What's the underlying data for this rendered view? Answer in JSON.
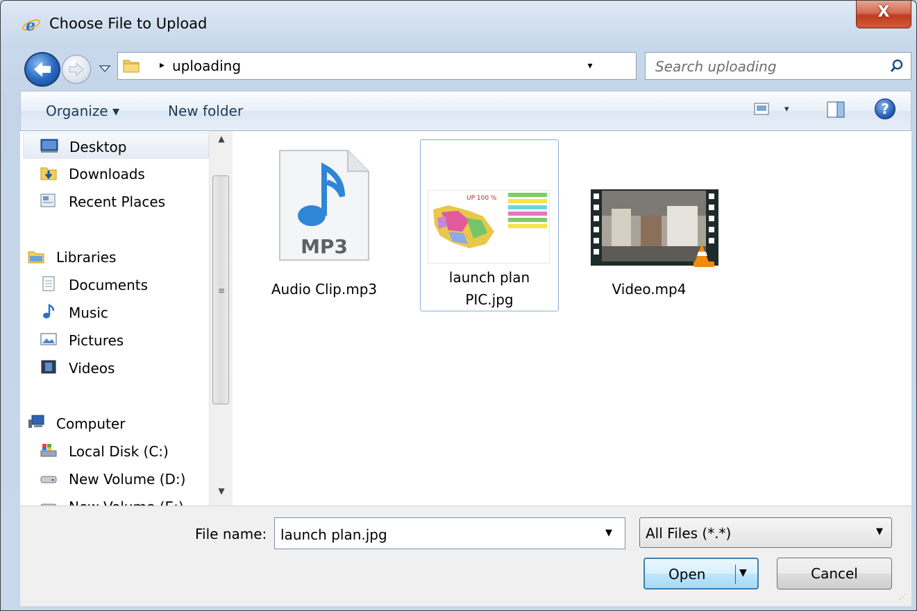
{
  "window": {
    "title": "Choose File to Upload",
    "close_label": "X"
  },
  "address": {
    "breadcrumb_arrow": "▸",
    "current_folder": "uploading",
    "dropdown_glyph": "▾",
    "refresh_glyph": "↻"
  },
  "search": {
    "placeholder": "Search uploading"
  },
  "toolbar": {
    "organize_label": "Organize ▾",
    "new_folder_label": "New folder",
    "view_dropdown": "▾",
    "help_label": "?"
  },
  "navigation": {
    "items": [
      {
        "label": "Desktop",
        "icon": "desktop-icon",
        "selected": true
      },
      {
        "label": "Downloads",
        "icon": "downloads-folder-icon"
      },
      {
        "label": "Recent Places",
        "icon": "recent-places-icon"
      },
      {
        "label": "Libraries",
        "icon": "libraries-icon"
      },
      {
        "label": "Documents",
        "icon": "documents-icon"
      },
      {
        "label": "Music",
        "icon": "music-icon"
      },
      {
        "label": "Pictures",
        "icon": "pictures-icon"
      },
      {
        "label": "Videos",
        "icon": "videos-icon"
      },
      {
        "label": "Computer",
        "icon": "computer-icon"
      },
      {
        "label": "Local Disk (C:)",
        "icon": "local-disk-icon"
      },
      {
        "label": "New Volume (D:)",
        "icon": "drive-icon"
      },
      {
        "label": "New Volume (E:)",
        "icon": "drive-icon"
      }
    ]
  },
  "files": [
    {
      "name": "Audio Clip.mp3",
      "icon": "mp3-file-icon",
      "badge": "MP3"
    },
    {
      "name_line1": "launch plan",
      "name_line2": "PIC.jpg",
      "icon": "image-thumbnail-icon",
      "selected": true,
      "thumb_caption": "UP 100 %"
    },
    {
      "name": "Video.mp4",
      "icon": "video-thumbnail-icon"
    }
  ],
  "bottom": {
    "file_name_label": "File name:",
    "file_name_value": "launch plan.jpg",
    "file_type_value": "All Files (*.*)",
    "open_label": "Open",
    "cancel_label": "Cancel"
  },
  "colors": {
    "accent": "#2b6cc4",
    "selection_border": "#84acdd",
    "close": "#c03b1f"
  }
}
